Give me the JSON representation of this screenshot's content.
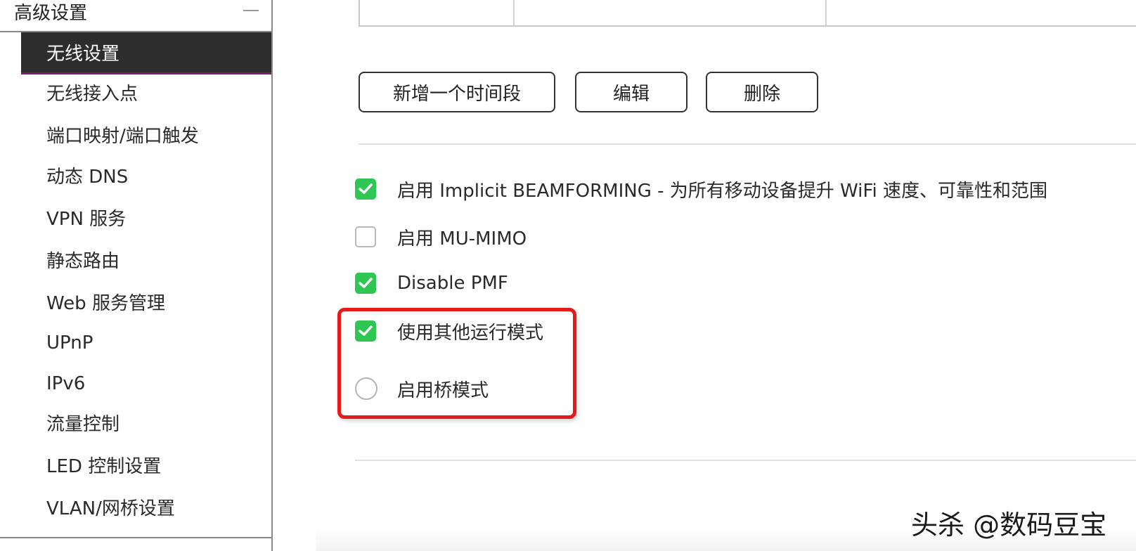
{
  "sidebar": {
    "header": "高级设置",
    "active_item": "无线设置",
    "items": [
      {
        "label": "无线接入点"
      },
      {
        "label": "端口映射/端口触发"
      },
      {
        "label": "动态 DNS"
      },
      {
        "label": "VPN 服务"
      },
      {
        "label": "静态路由"
      },
      {
        "label": "Web 服务管理"
      },
      {
        "label": "UPnP"
      },
      {
        "label": "IPv6"
      },
      {
        "label": "流量控制"
      },
      {
        "label": "LED 控制设置"
      },
      {
        "label": "VLAN/网桥设置"
      }
    ]
  },
  "toolbar": {
    "add_label": "新增一个时间段",
    "edit_label": "编辑",
    "delete_label": "删除"
  },
  "options": [
    {
      "label": "启用 Implicit BEAMFORMING - 为所有移动设备提升 WiFi 速度、可靠性和范围",
      "checked": true,
      "kind": "checkbox"
    },
    {
      "label": "启用 MU-MIMO",
      "checked": false,
      "kind": "checkbox"
    },
    {
      "label": "Disable PMF",
      "checked": true,
      "kind": "checkbox"
    },
    {
      "label": "使用其他运行模式",
      "checked": true,
      "kind": "checkbox"
    },
    {
      "label": "启用桥模式",
      "checked": false,
      "kind": "radio"
    }
  ],
  "watermark": "头杀 @数码豆宝",
  "colors": {
    "checkbox_on": "#2fc653",
    "highlight": "#e51b1b",
    "active_bg": "#2d2d2d",
    "active_underline": "#7b1d74"
  }
}
